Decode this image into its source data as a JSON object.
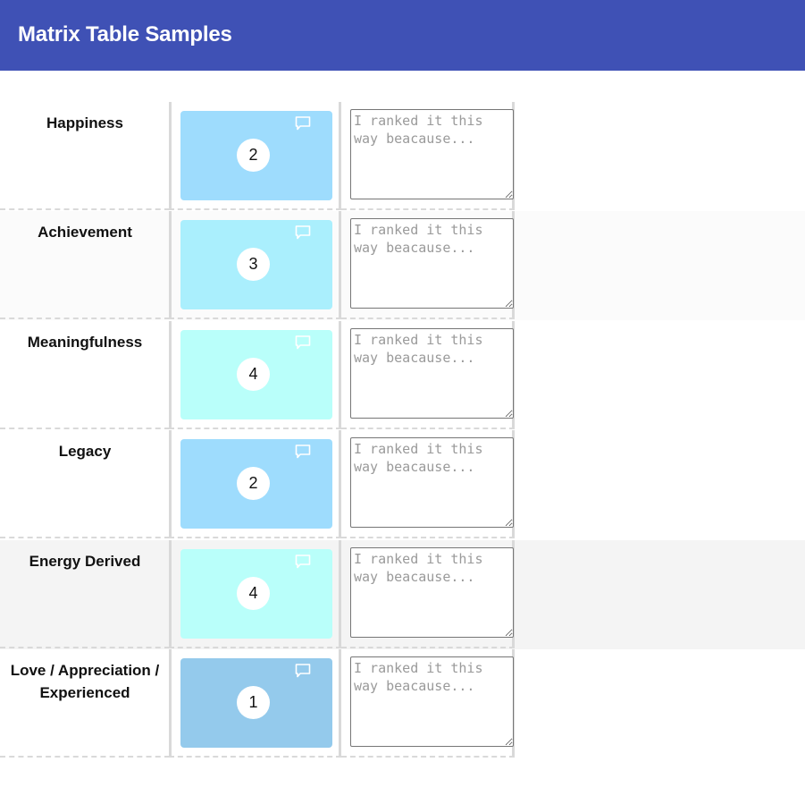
{
  "header": {
    "title": "Matrix Table Samples"
  },
  "rows": [
    {
      "label": "Happiness",
      "rank": "2",
      "card_color": "#9edcfd",
      "row_bg": "#ffffff",
      "note_placeholder": "I ranked it this way beacause..."
    },
    {
      "label": "Achievement",
      "rank": "3",
      "card_color": "#aaeffd",
      "row_bg": "#fbfbfb",
      "note_placeholder": "I ranked it this way beacause..."
    },
    {
      "label": "Meaningfulness",
      "rank": "4",
      "card_color": "#b9fffa",
      "row_bg": "#ffffff",
      "note_placeholder": "I ranked it this way beacause..."
    },
    {
      "label": "Legacy",
      "rank": "2",
      "card_color": "#9edcfd",
      "row_bg": "#ffffff",
      "note_placeholder": "I ranked it this way beacause..."
    },
    {
      "label": "Energy Derived",
      "rank": "4",
      "card_color": "#b9fffa",
      "row_bg": "#f4f4f4",
      "note_placeholder": "I ranked it this way beacause..."
    },
    {
      "label": "Love / Appreciation / Experienced",
      "rank": "1",
      "card_color": "#94caec",
      "row_bg": "#ffffff",
      "note_placeholder": "I ranked it this way beacause..."
    }
  ],
  "icons": {
    "comment": "comment-bubble-icon"
  }
}
